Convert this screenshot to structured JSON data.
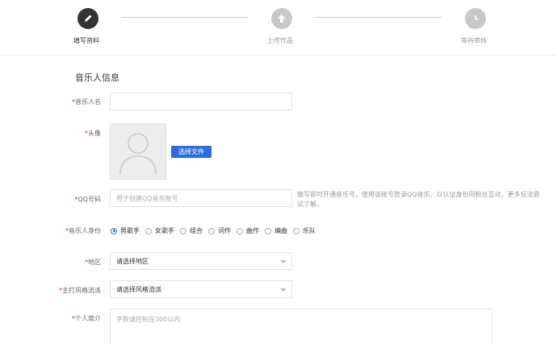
{
  "steps": [
    {
      "label": "填写资料",
      "icon": "pencil-icon",
      "active": true
    },
    {
      "label": "上传作品",
      "icon": "upload-arrow-icon",
      "active": false
    },
    {
      "label": "等待审核",
      "icon": "clock-icon",
      "active": false
    }
  ],
  "section_title": "音乐人信息",
  "required_mark": "*",
  "fields": {
    "name": {
      "label": "音乐人名",
      "value": ""
    },
    "avatar": {
      "label": "头像",
      "button": "选择文件"
    },
    "qq": {
      "label": "QQ号码",
      "placeholder": "用于创建QQ音乐账号",
      "hint": "填写即可开通音乐号，使用该账号登录QQ音乐，以认证身份同粉丝互动，更多玩法尝试了解。"
    },
    "identity": {
      "label": "音乐人身份",
      "options": [
        "男歌手",
        "女歌手",
        "组合",
        "词作",
        "曲作",
        "编曲",
        "乐队"
      ],
      "selected": "男歌手"
    },
    "region": {
      "label": "地区",
      "selected": "请选择地区"
    },
    "genre": {
      "label": "主打风格流派",
      "selected": "请选择风格流派"
    },
    "bio": {
      "label": "个人简介",
      "placeholder": "字数请控制在300以内"
    }
  },
  "colors": {
    "accent": "#2b6ee2",
    "required": "#e02020",
    "step_active": "#333333",
    "step_inactive": "#c8c8c8"
  }
}
